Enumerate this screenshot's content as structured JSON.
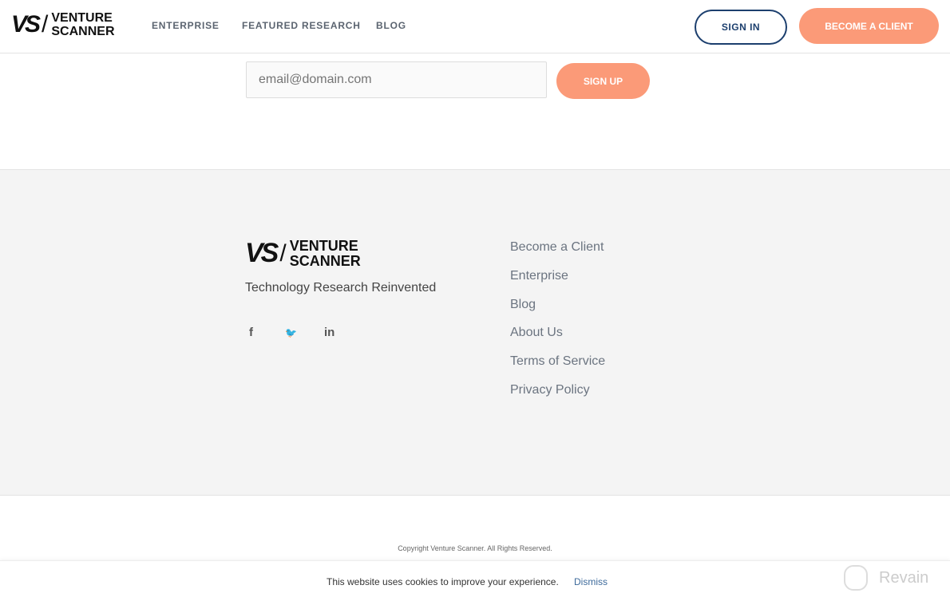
{
  "header": {
    "logo_mark": "VS",
    "logo_line1": "VENTURE",
    "logo_line2": "SCANNER",
    "nav": [
      "ENTERPRISE",
      "FEATURED RESEARCH",
      "BLOG"
    ],
    "sign_in": "SIGN IN",
    "become_client": "BECOME A CLIENT"
  },
  "signup": {
    "email_placeholder": "email@domain.com",
    "button": "SIGN UP"
  },
  "footer": {
    "tagline": "Technology Research Reinvented",
    "social": [
      {
        "icon": "facebook-icon",
        "glyph": "f"
      },
      {
        "icon": "twitter-icon",
        "glyph": "🐦"
      },
      {
        "icon": "linkedin-icon",
        "glyph": "in"
      }
    ],
    "links": [
      "Become a Client",
      "Enterprise",
      "Blog",
      "About Us",
      "Terms of Service",
      "Privacy Policy"
    ],
    "copyright": "Copyright Venture Scanner. All Rights Reserved."
  },
  "cookie": {
    "text": "This website uses cookies to improve your experience.",
    "dismiss": "Dismiss"
  },
  "watermark": "Revain",
  "colors": {
    "accent": "#fb9a78",
    "navy": "#1c3f6e"
  }
}
